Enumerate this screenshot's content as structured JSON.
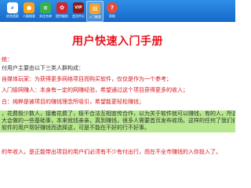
{
  "toolbar": {
    "items": [
      {
        "label": "综合搜索",
        "icon": "search-icon",
        "color": "#ffffff",
        "glyph": "⌕"
      },
      {
        "label": "人脉搜索",
        "icon": "people-icon",
        "color": "#f7a21b",
        "glyph": "●"
      },
      {
        "label": "关注名单",
        "icon": "list-icon",
        "color": "#36b24a",
        "glyph": "≡"
      },
      {
        "label": "提供服务",
        "icon": "service-icon",
        "color": "#d4262e",
        "glyph": "✿"
      },
      {
        "label": "会员中心",
        "icon": "vip-icon",
        "color": "#8b1a1a",
        "glyph": "VIP"
      },
      {
        "label": "入门教程",
        "icon": "book-icon",
        "color": "#f0a22e",
        "glyph": "▤"
      },
      {
        "label": "帮助",
        "icon": "help-icon",
        "color": "#e74c3c",
        "glyph": "?"
      }
    ],
    "active_index": 5,
    "bar_color": "#1d72d4"
  },
  "title": "用户快速入门手册",
  "content": {
    "lines": [
      {
        "text": "统：",
        "style": "red"
      },
      {
        "text": "付用户主要由以下三类人群构成：",
        "style": "dark"
      },
      {
        "text": "自媒体玩家：为获得更多网络项目而购买软件，仅仅是作为一个参考；",
        "style": "red"
      },
      {
        "text": "入门级网赚人：本身有一定的网赚经验，希望通过这个项目获得更多的收入；",
        "style": "red"
      },
      {
        "text": "白：纯粹是被项目的赚钱理念所吸引，希望能更轻松赚钱；",
        "style": "red"
      },
      {
        "text": "，花费极少数人，接着花费了，极不合法互相宣传合作，以为关于软件就可以赚钱，有的人，所选项目",
        "style": "dark"
      },
      {
        "text": "大会做的一些基础事，本来就钱亲亲，真到赚钱，很多人需要首页发布收场。这样的任何了我们们现实的。",
        "style": "dark"
      },
      {
        "text": "软件的用户帮好赚钱而选择这，可是不能在不好的行不好事。",
        "style": "dark"
      },
      {
        "text": "的年收入，是正能带出项目的用户们必须有不少有付出行，而在不全市赚钱的入你投入了。",
        "style": "red"
      }
    ],
    "highlight_color": "#b7e78e"
  }
}
